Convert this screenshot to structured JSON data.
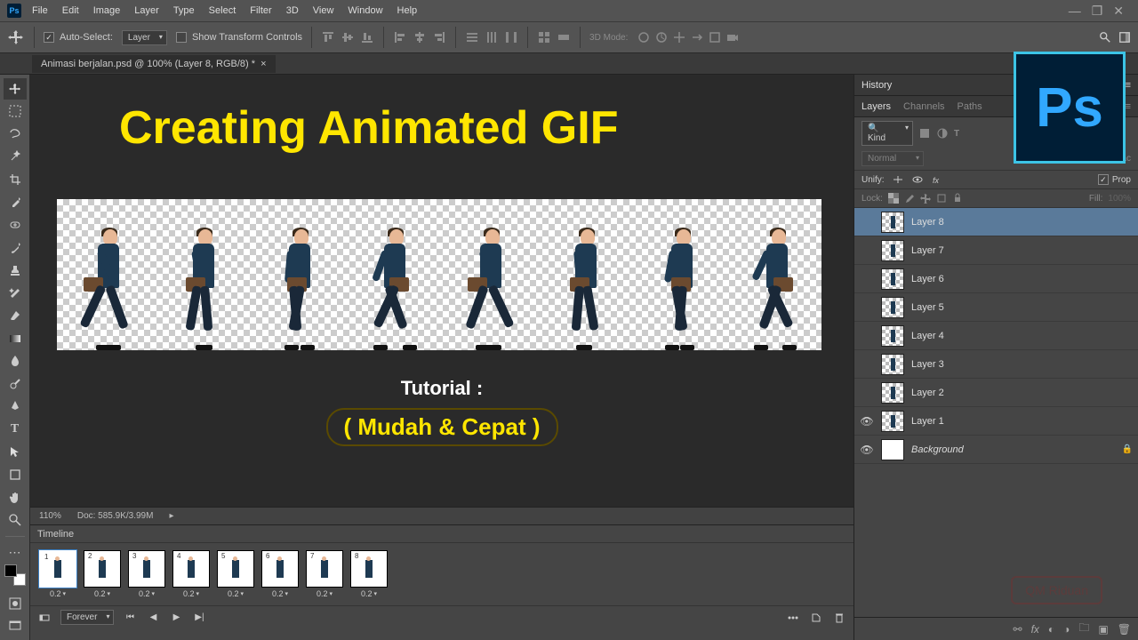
{
  "menu": [
    "File",
    "Edit",
    "Image",
    "Layer",
    "Type",
    "Select",
    "Filter",
    "3D",
    "View",
    "Window",
    "Help"
  ],
  "options": {
    "auto_select": "Auto-Select:",
    "auto_select_target": "Layer",
    "show_transform": "Show Transform Controls",
    "mode_3d": "3D Mode:"
  },
  "doc_tab": "Animasi berjalan.psd @ 100% (Layer 8, RGB/8) *",
  "overlay": {
    "title": "Creating Animated GIF",
    "sub": "Tutorial :",
    "sub2": "( Mudah & Cepat )"
  },
  "status": {
    "zoom": "110%",
    "doc": "Doc: 585.9K/3.99M"
  },
  "timeline": {
    "title": "Timeline",
    "frames": [
      {
        "n": "1",
        "delay": "0.2"
      },
      {
        "n": "2",
        "delay": "0.2"
      },
      {
        "n": "3",
        "delay": "0.2"
      },
      {
        "n": "4",
        "delay": "0.2"
      },
      {
        "n": "5",
        "delay": "0.2"
      },
      {
        "n": "6",
        "delay": "0.2"
      },
      {
        "n": "7",
        "delay": "0.2"
      },
      {
        "n": "8",
        "delay": "0.2"
      }
    ],
    "loop": "Forever"
  },
  "panels": {
    "history": "History",
    "layers_tabs": [
      "Layers",
      "Channels",
      "Paths"
    ],
    "filter_kind": "Kind",
    "blend": "Normal",
    "opacity_label": "Opac",
    "unify": "Unify:",
    "propagate": "Prop",
    "lock": "Lock:",
    "fill": "Fill:",
    "fill_val": "100%"
  },
  "layers": [
    {
      "name": "Layer 8",
      "visible": false,
      "selected": true,
      "bg": false
    },
    {
      "name": "Layer 7",
      "visible": false,
      "selected": false,
      "bg": false
    },
    {
      "name": "Layer 6",
      "visible": false,
      "selected": false,
      "bg": false
    },
    {
      "name": "Layer 5",
      "visible": false,
      "selected": false,
      "bg": false
    },
    {
      "name": "Layer 4",
      "visible": false,
      "selected": false,
      "bg": false
    },
    {
      "name": "Layer 3",
      "visible": false,
      "selected": false,
      "bg": false
    },
    {
      "name": "Layer 2",
      "visible": false,
      "selected": false,
      "bg": false
    },
    {
      "name": "Layer 1",
      "visible": true,
      "selected": false,
      "bg": false
    },
    {
      "name": "Background",
      "visible": true,
      "selected": false,
      "bg": true
    }
  ],
  "ps_badge": "Ps",
  "watermark": "QM Riduan"
}
